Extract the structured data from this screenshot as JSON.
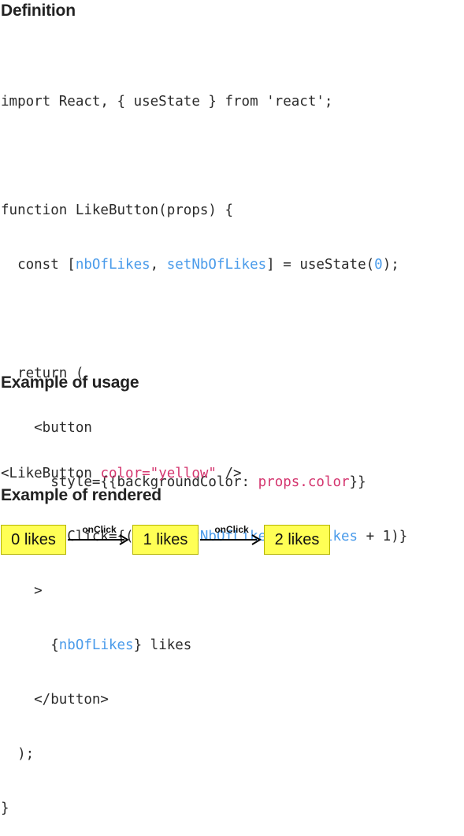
{
  "headings": {
    "definition": "Definition",
    "usage": "Example of usage",
    "rendered": "Example of rendered"
  },
  "code_definition": {
    "l1": "import React, { useState } from 'react';",
    "l3": "function LikeButton(props) {",
    "l4_a": "  const [",
    "l4_b": "nbOfLikes",
    "l4_c": ", ",
    "l4_d": "setNbOfLikes",
    "l4_e": "] = useState(",
    "l4_f": "0",
    "l4_g": ");",
    "l6": "  return (",
    "l7": "    <button",
    "l8_a": "      style={{backgroundColor: ",
    "l8_b": "props.color",
    "l8_c": "}}",
    "l9_a": "      onClick={() => ",
    "l9_b": "setNbOfLikes",
    "l9_c": "(",
    "l9_d": "nbOfLikes",
    "l9_e": " + 1)}",
    "l10": "    >",
    "l11_a": "      {",
    "l11_b": "nbOfLikes",
    "l11_c": "} likes",
    "l12": "    </button>",
    "l13": "  );",
    "l14": "}"
  },
  "code_usage": {
    "a": "<LikeButton ",
    "b": "color=\"yellow\"",
    "c": " />"
  },
  "rendered": {
    "buttons": [
      "0 likes",
      "1 likes",
      "2 likes"
    ],
    "arrow_label": "onClick",
    "button_color": "#ffff55"
  },
  "colors": {
    "identifier": "#4a9bea",
    "prop_string": "#d4366f"
  }
}
